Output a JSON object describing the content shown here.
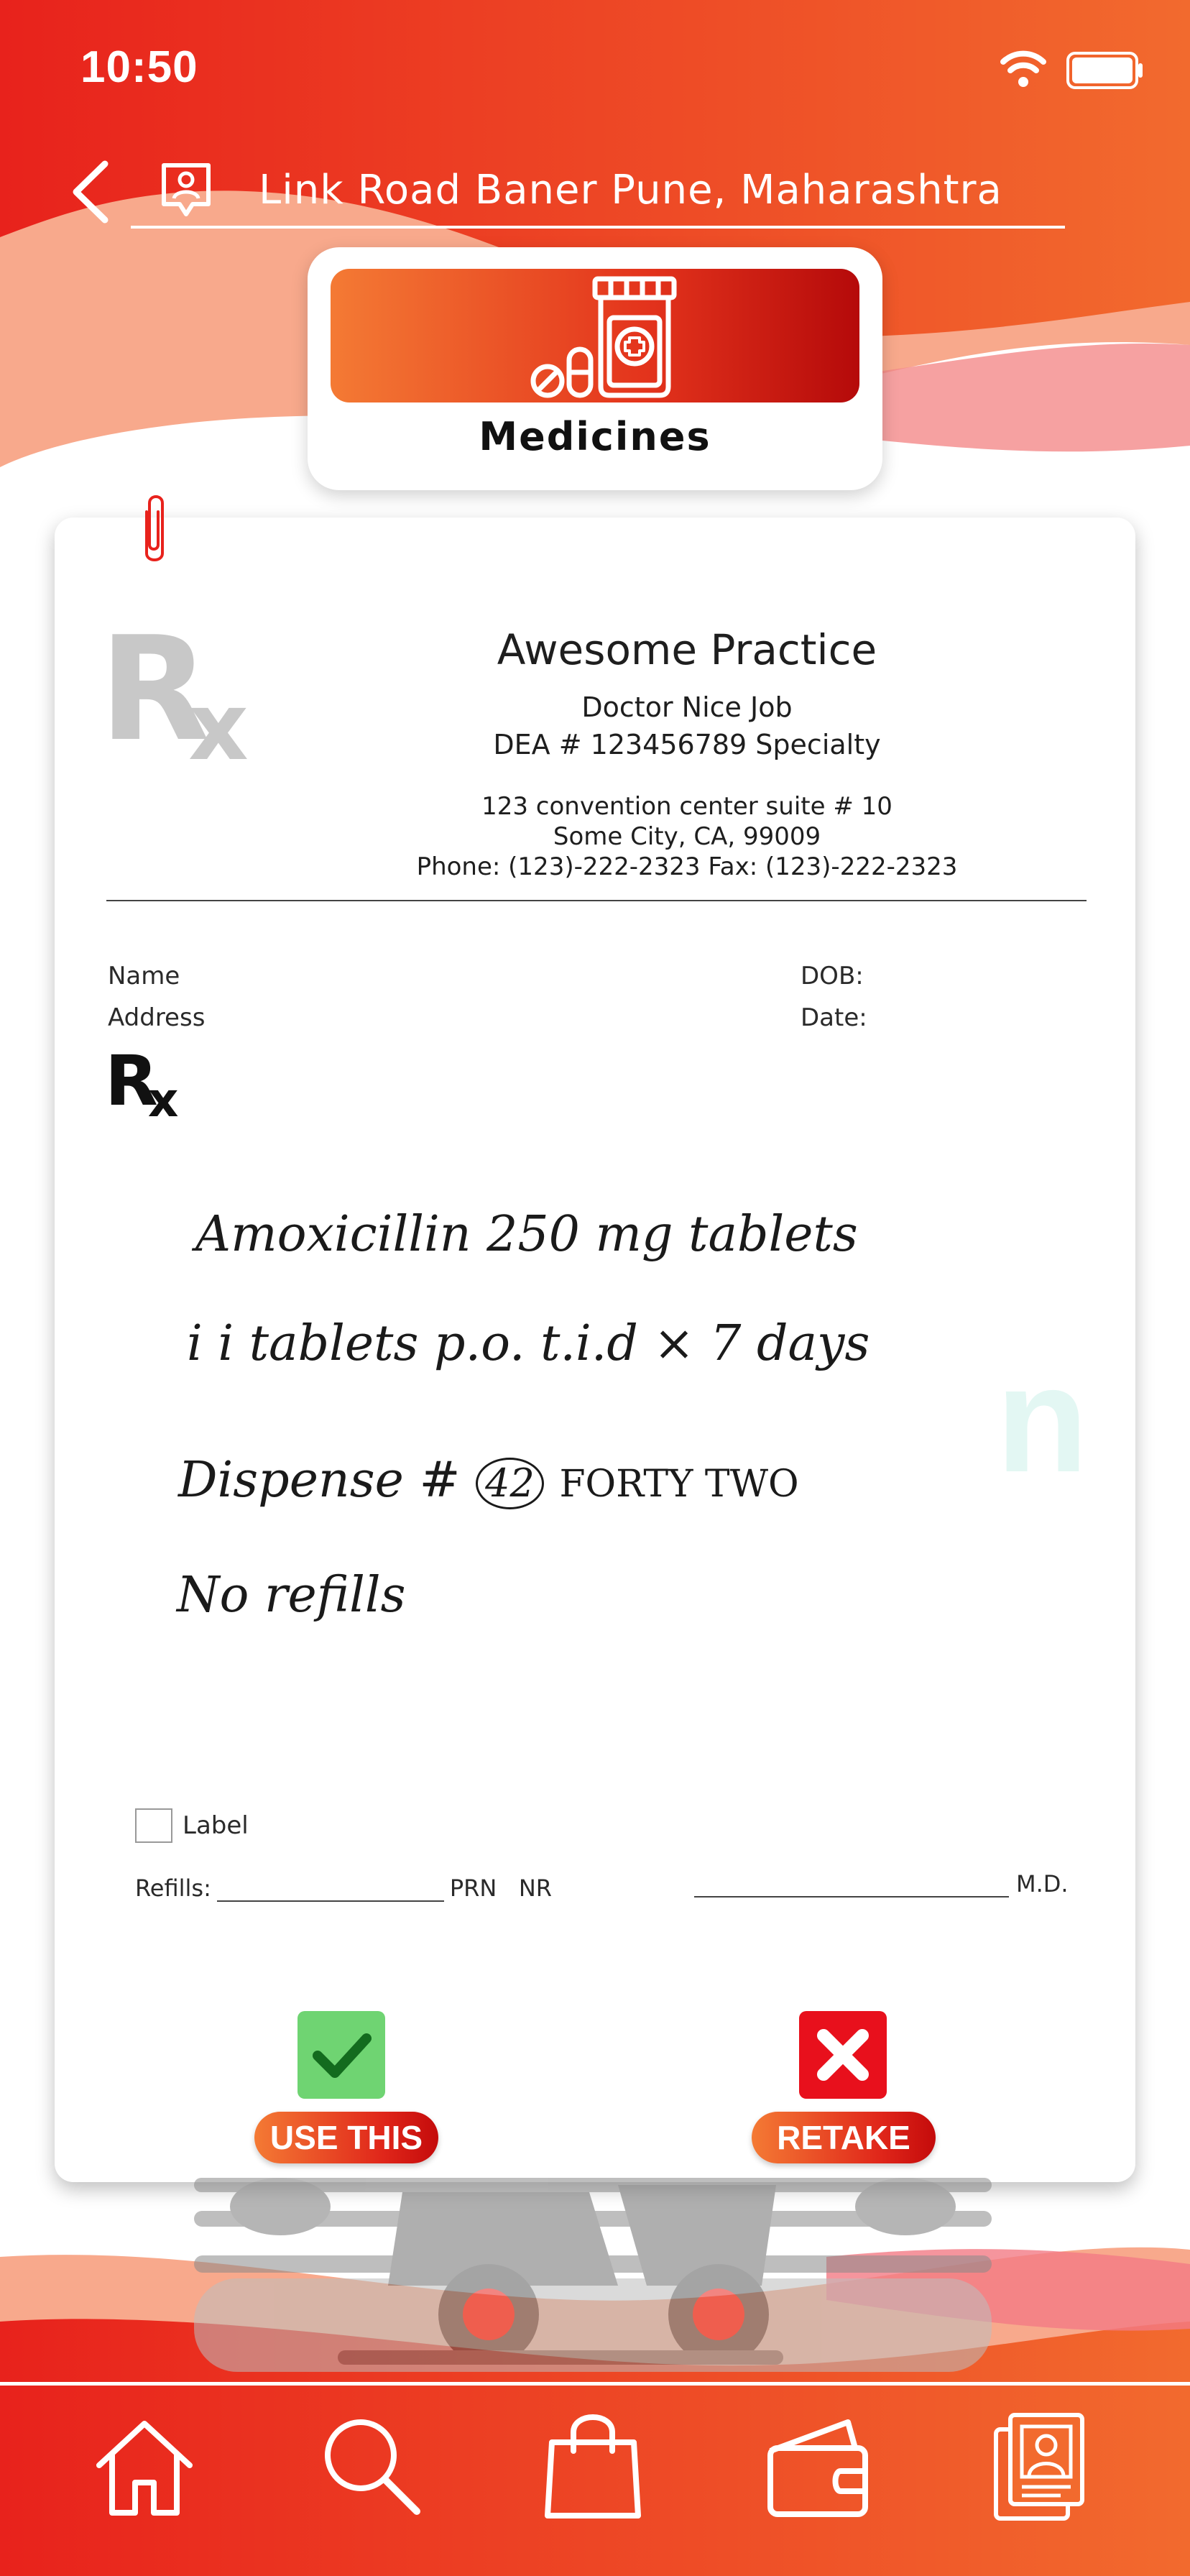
{
  "status_bar": {
    "time": "10:50"
  },
  "header": {
    "location": "Link Road Baner Pune, Maharashtra"
  },
  "category": {
    "label": "Medicines"
  },
  "prescription": {
    "practice_name": "Awesome Practice",
    "doctor": "Doctor Nice Job",
    "dea": "DEA # 123456789 Specialty",
    "address_line1": "123 convention center suite # 10",
    "address_line2": "Some City, CA, 99009",
    "phone_fax": "Phone: (123)-222-2323 Fax: (123)-222-2323",
    "name_label": "Name",
    "address_label": "Address",
    "dob_label": "DOB:",
    "date_label": "Date:",
    "handwriting": {
      "line1": "Amoxicillin 250 mg tablets",
      "line2": "i i tablets p.o. t.i.d × 7 days",
      "line3_prefix": "Dispense #",
      "line3_qty": "42",
      "line3_suffix": "FORTY TWO",
      "line4": "No refills"
    },
    "label_checkbox": "Label",
    "refills_label": "Refills:",
    "prn": "PRN",
    "nr": "NR",
    "md": "M.D."
  },
  "actions": {
    "use_this": "USE THIS",
    "retake": "RETAKE"
  },
  "nav": {
    "items": [
      "home-icon",
      "search-icon",
      "bag-icon",
      "wallet-icon",
      "profile-icon"
    ]
  },
  "colors": {
    "brand_red": "#e8221c",
    "brand_orange": "#f47a34",
    "use_this_green": "#6fd472",
    "retake_red": "#e8101c"
  }
}
